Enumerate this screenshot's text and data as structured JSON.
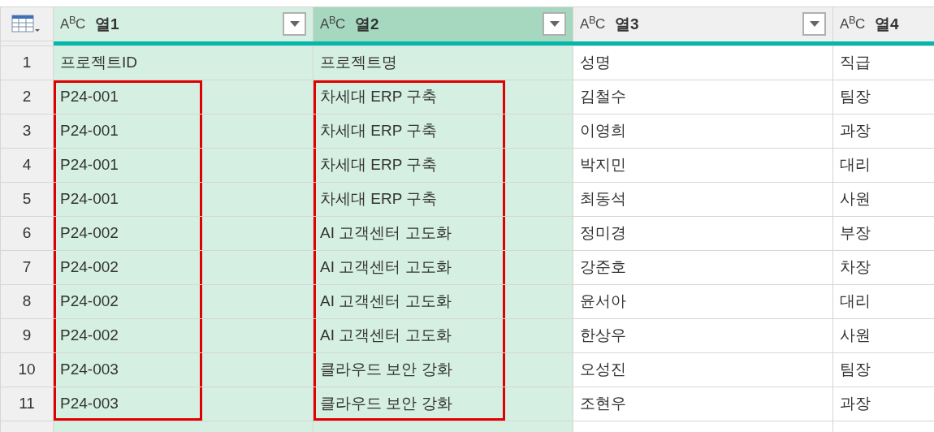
{
  "columns": [
    {
      "type_label": "A$^{B}$C",
      "name": "열1",
      "selected": true,
      "focused": false,
      "outlined": true
    },
    {
      "type_label": "A$^{B}$C",
      "name": "열2",
      "selected": true,
      "focused": true,
      "outlined": true
    },
    {
      "type_label": "A$^{B}$C",
      "name": "열3",
      "selected": false,
      "focused": false,
      "outlined": false
    },
    {
      "type_label": "A$^{B}$C",
      "name": "열4",
      "selected": false,
      "focused": false,
      "outlined": false
    }
  ],
  "rows": [
    {
      "number": "1",
      "outlined": false,
      "cells": [
        "프로젝트ID",
        "프로젝트명",
        "성명",
        "직급"
      ]
    },
    {
      "number": "2",
      "outlined": true,
      "cells": [
        "P24-001",
        "차세대 ERP 구축",
        "김철수",
        "팀장"
      ]
    },
    {
      "number": "3",
      "outlined": true,
      "cells": [
        "P24-001",
        "차세대 ERP 구축",
        "이영희",
        "과장"
      ]
    },
    {
      "number": "4",
      "outlined": true,
      "cells": [
        "P24-001",
        "차세대 ERP 구축",
        "박지민",
        "대리"
      ]
    },
    {
      "number": "5",
      "outlined": true,
      "cells": [
        "P24-001",
        "차세대 ERP 구축",
        "최동석",
        "사원"
      ]
    },
    {
      "number": "6",
      "outlined": true,
      "cells": [
        "P24-002",
        "AI 고객센터 고도화",
        "정미경",
        "부장"
      ]
    },
    {
      "number": "7",
      "outlined": true,
      "cells": [
        "P24-002",
        "AI 고객센터 고도화",
        "강준호",
        "차장"
      ]
    },
    {
      "number": "8",
      "outlined": true,
      "cells": [
        "P24-002",
        "AI 고객센터 고도화",
        "윤서아",
        "대리"
      ]
    },
    {
      "number": "9",
      "outlined": true,
      "cells": [
        "P24-002",
        "AI 고객센터 고도화",
        "한상우",
        "사원"
      ]
    },
    {
      "number": "10",
      "outlined": true,
      "cells": [
        "P24-003",
        "클라우드 보안 강화",
        "오성진",
        "팀장"
      ]
    },
    {
      "number": "11",
      "outlined": true,
      "cells": [
        "P24-003",
        "클라우드 보안 강화",
        "조현우",
        "과장"
      ]
    }
  ]
}
